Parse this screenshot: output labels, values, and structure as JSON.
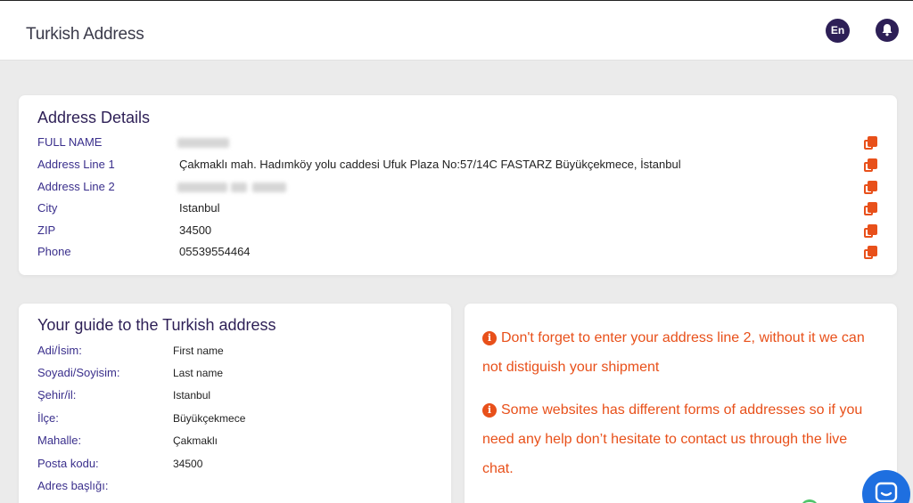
{
  "header": {
    "title": "Turkish Address",
    "language_label": "En",
    "notifications_icon": "bell-icon"
  },
  "address_details": {
    "title": "Address Details",
    "rows": [
      {
        "label": "FULL NAME",
        "value": ""
      },
      {
        "label": "Address Line 1",
        "value": "Çakmaklı mah. Hadımköy yolu caddesi Ufuk Plaza No:57/14C FASTARZ Büyükçekmece, İstanbul"
      },
      {
        "label": "Address Line 2",
        "value": ""
      },
      {
        "label": "City",
        "value": "Istanbul"
      },
      {
        "label": "ZIP",
        "value": "34500"
      },
      {
        "label": "Phone",
        "value": "05539554464"
      }
    ],
    "copy_icon": "copy-icon"
  },
  "guide": {
    "title": "Your guide to the Turkish address",
    "rows": [
      {
        "label": "Adi/İsim:",
        "value": "First name"
      },
      {
        "label": "Soyadi/Soyisim:",
        "value": "Last name"
      },
      {
        "label": "Şehir/il:",
        "value": "Istanbul"
      },
      {
        "label": "İlçe:",
        "value": "Büyükçekmece"
      },
      {
        "label": "Mahalle:",
        "value": "Çakmaklı"
      },
      {
        "label": "Posta kodu:",
        "value": "34500"
      },
      {
        "label": "Adres başlığı:",
        "value": ""
      }
    ]
  },
  "info": {
    "notes": [
      "Don't forget to enter your address line 2, without it we can not distiguish your shipment",
      "Some websites has different forms of addresses so if you need any help don’t hesitate to contact us through the live chat."
    ],
    "icon": "info-circle-icon"
  },
  "chat": {
    "icon": "chat-icon"
  },
  "colors": {
    "brand": "#2d1f56",
    "label": "#3a2f8c",
    "accent": "#e8501a",
    "chat": "#1e6fe0",
    "background": "#ebebeb"
  }
}
